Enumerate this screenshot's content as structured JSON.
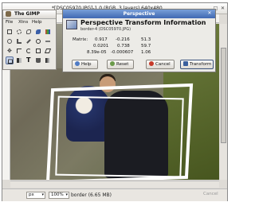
{
  "image_window": {
    "title": "*[DSC05970.JPG]-1.0 (RGB, 3 layers) 640x480",
    "status": {
      "unit": "px",
      "zoom": "100%",
      "message": "border (6.65 MB)",
      "cancel_label": "Cancel"
    }
  },
  "toolbox": {
    "title": "The GIMP",
    "menu": [
      "File",
      "Xtns",
      "Help"
    ]
  },
  "dialog": {
    "window_title": "Perspective",
    "heading": "Perspective Transform Information",
    "subtitle": "border-4 (DSC05970.JPG)",
    "matrix_label": "Matrix:",
    "matrix": [
      [
        "0.917",
        "-0.216",
        "51.3"
      ],
      [
        "0.0201",
        "0.738",
        "59.7"
      ],
      [
        "8.39e-05",
        "-0.000607",
        "1.06"
      ]
    ],
    "buttons": {
      "help": "Help",
      "reset": "Reset",
      "cancel": "Cancel",
      "transform": "Transform"
    }
  },
  "colors": {
    "dialog_title_bar": "#3f68b2",
    "selection": "#c8d4ea"
  }
}
